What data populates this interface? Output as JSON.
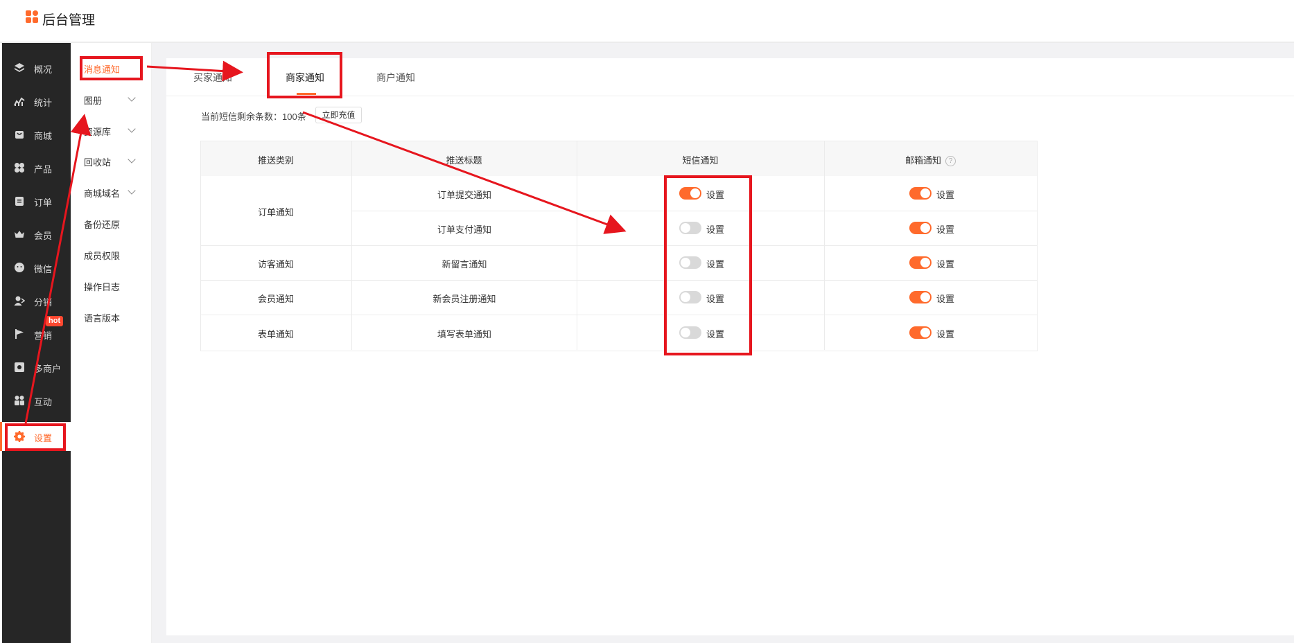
{
  "header": {
    "app_title": "后台管理"
  },
  "main_nav": [
    {
      "label": "概况",
      "icon": "layers-icon"
    },
    {
      "label": "统计",
      "icon": "chart-icon"
    },
    {
      "label": "商城",
      "icon": "store-icon"
    },
    {
      "label": "产品",
      "icon": "grid-icon"
    },
    {
      "label": "订单",
      "icon": "clipboard-icon"
    },
    {
      "label": "会员",
      "icon": "crown-icon"
    },
    {
      "label": "微信",
      "icon": "wechat-icon"
    },
    {
      "label": "分销",
      "icon": "user-share-icon"
    },
    {
      "label": "营销",
      "icon": "flag-icon"
    },
    {
      "label": "多商户",
      "icon": "merchant-icon"
    },
    {
      "label": "互动",
      "icon": "people-icon"
    },
    {
      "label": "设置",
      "icon": "gear-icon",
      "active": true
    }
  ],
  "hot_badge": "hot",
  "sub_nav": [
    {
      "label": "消息通知",
      "active": true
    },
    {
      "label": "图册",
      "expandable": true
    },
    {
      "label": "资源库",
      "expandable": true
    },
    {
      "label": "回收站",
      "expandable": true
    },
    {
      "label": "商城域名",
      "expandable": true
    },
    {
      "label": "备份还原"
    },
    {
      "label": "成员权限"
    },
    {
      "label": "操作日志"
    },
    {
      "label": "语言版本"
    }
  ],
  "tabs": [
    {
      "label": "买家通知"
    },
    {
      "label": "商家通知",
      "active": true
    },
    {
      "label": "商户通知"
    }
  ],
  "sms": {
    "remaining_text": "当前短信剩余条数：100条",
    "recharge_label": "立即充值"
  },
  "table": {
    "headers": [
      "推送类别",
      "推送标题",
      "短信通知",
      "邮箱通知"
    ],
    "groups": [
      "订单通知",
      "访客通知",
      "会员通知",
      "表单通知"
    ],
    "rows": [
      {
        "title": "订单提交通知",
        "sms_on": true,
        "email_on": true
      },
      {
        "title": "订单支付通知",
        "sms_on": false,
        "email_on": true
      },
      {
        "title": "新留言通知",
        "sms_on": false,
        "email_on": true
      },
      {
        "title": "新会员注册通知",
        "sms_on": false,
        "email_on": true
      },
      {
        "title": "填写表单通知",
        "sms_on": false,
        "email_on": true
      }
    ],
    "set_label": "设置",
    "help_glyph": "?"
  },
  "colors": {
    "accent": "#ff6a2c",
    "annotation": "#e6161e",
    "sidebar": "#262626"
  }
}
